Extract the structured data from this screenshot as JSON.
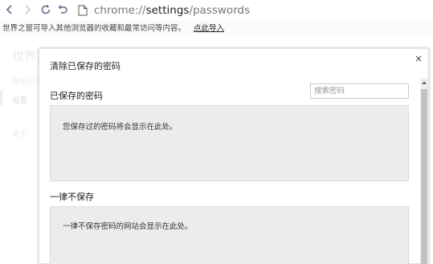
{
  "toolbar": {
    "url_prefix": "chrome://",
    "url_path": "settings",
    "url_suffix": "/passwords"
  },
  "infobar": {
    "message": "世界之窗可导入其他浏览器的收藏和最常访问等内容。",
    "import_link": "点此导入"
  },
  "background": {
    "title": "世界之窗",
    "history": "历史记录",
    "settings": "设置",
    "about": "关于"
  },
  "dialog": {
    "title": "清除已保存的密码",
    "close_label": "×",
    "saved_passwords": {
      "heading": "已保存的密码",
      "search_placeholder": "搜索密码",
      "empty_text": "您保存过的密码将会显示在此处。"
    },
    "never_saved": {
      "heading": "一律不保存",
      "empty_text": "一律不保存密码的网站会显示在此处。"
    }
  },
  "colors": {
    "dialog_bg": "#ffffff",
    "panel_bg": "#ececec",
    "infobar_bg": "#fafafa",
    "nav_icon": "#5f6a8a",
    "scroll_thumb": "#c2c2c2"
  },
  "icons": {
    "back": "arrow-left-icon",
    "forward": "arrow-right-icon",
    "reload": "reload-icon",
    "undo": "undo-icon",
    "page": "page-icon",
    "close": "close-icon"
  }
}
